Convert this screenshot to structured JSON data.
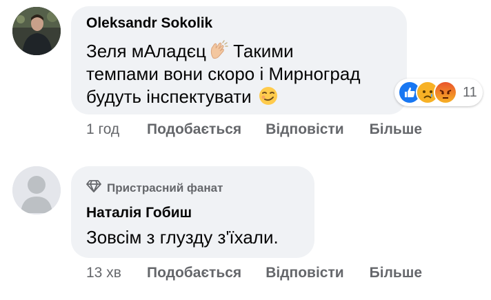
{
  "comments": [
    {
      "author": "Oleksandr Sokolik",
      "text_line1": "Зеля мАладєц",
      "text_line1b": " Такими",
      "text_line2": "темпами вони скоро і Мирноград",
      "text_line3": "будуть інспектувати",
      "emoji_inline1": "clapping-hands-icon",
      "emoji_inline2": "smirking-face-icon",
      "reactions": {
        "icons": [
          "like-icon",
          "sad-face-icon",
          "angry-face-icon"
        ],
        "count": "11"
      },
      "time": "1 год",
      "actions": [
        "Подобається",
        "Відповісти",
        "Більше"
      ]
    },
    {
      "badge": "Пристрасний фанат",
      "badge_icon": "diamond-icon",
      "author": "Наталія Гобиш",
      "text": "Зовсім з глузду з'їхали.",
      "time": "13 хв",
      "actions": [
        "Подобається",
        "Відповісти",
        "Більше"
      ]
    }
  ],
  "colors": {
    "bubble": "#f0f2f5",
    "secondary_text": "#65676b",
    "like_blue": "#1877f2"
  }
}
